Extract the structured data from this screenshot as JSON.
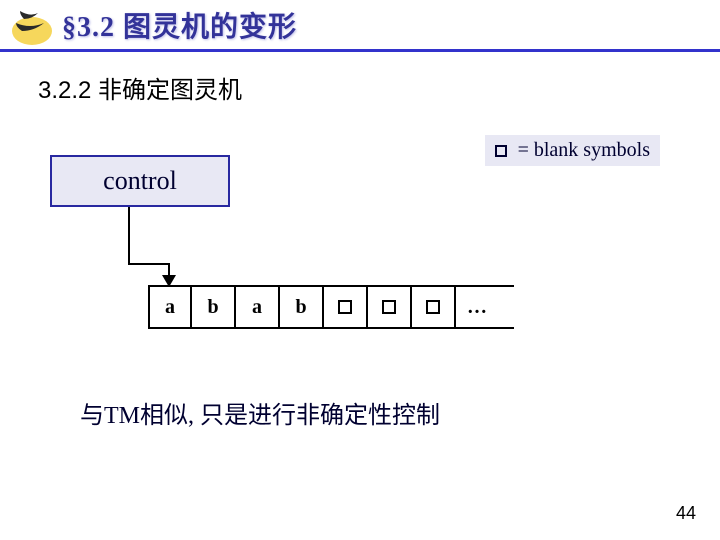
{
  "header": {
    "title": "§3.2 图灵机的变形"
  },
  "subtitle": "3.2.2 非确定图灵机",
  "diagram": {
    "legend_text": " = blank symbols",
    "control_label": "control",
    "tape_cells": [
      "a",
      "b",
      "a",
      "b",
      "□",
      "□",
      "□"
    ],
    "ellipsis": "…"
  },
  "note": "与TM相似, 只是进行非确定性控制",
  "page_number": "44"
}
